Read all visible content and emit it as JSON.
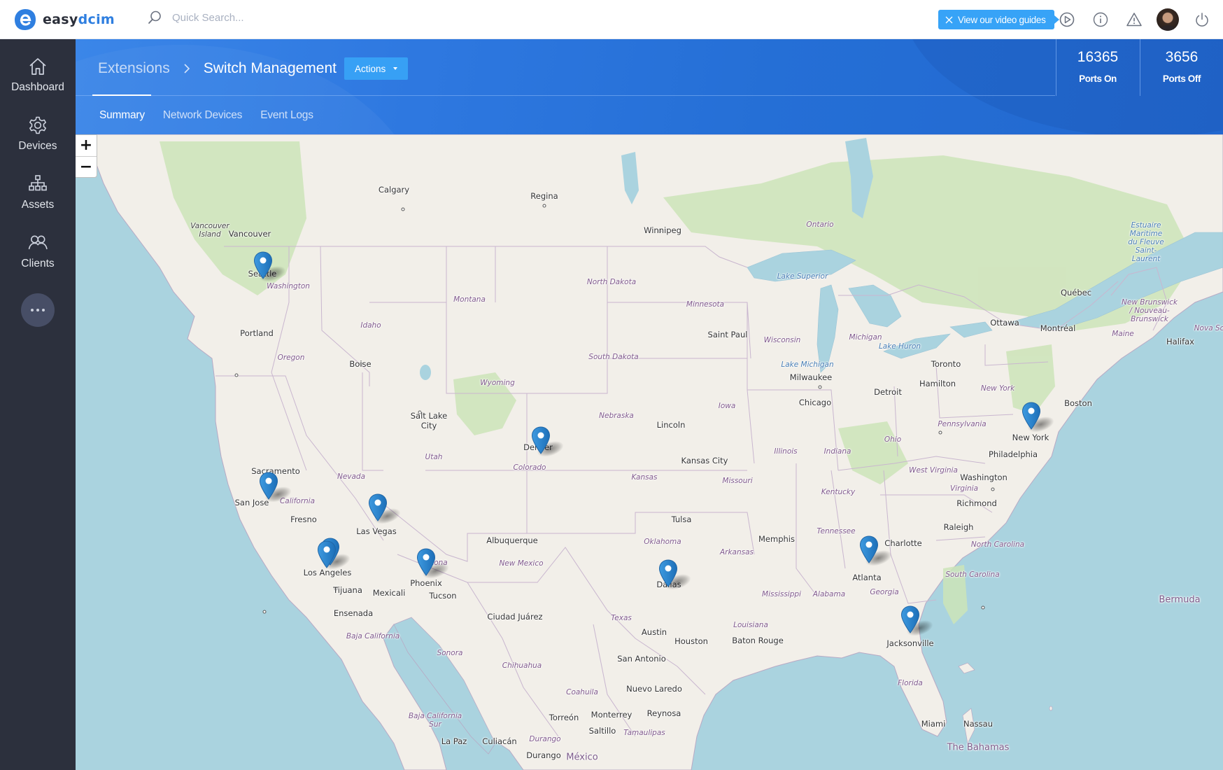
{
  "topbar": {
    "logo": {
      "prefix": "easy",
      "suffix": "dcim"
    },
    "search_placeholder": "Quick Search...",
    "video_guide_label": "View our video guides",
    "icons": [
      "search-icon",
      "close-icon",
      "play-circle-icon",
      "info-icon",
      "warning-icon",
      "avatar",
      "power-icon"
    ]
  },
  "sidebar": {
    "items": [
      {
        "label": "Dashboard",
        "icon": "home-icon"
      },
      {
        "label": "Devices",
        "icon": "gear-icon"
      },
      {
        "label": "Assets",
        "icon": "sitemap-icon"
      },
      {
        "label": "Clients",
        "icon": "users-icon"
      }
    ],
    "more_icon": "more-horizontal-icon"
  },
  "header": {
    "breadcrumb": {
      "parent": "Extensions",
      "current": "Switch Management"
    },
    "actions_label": "Actions",
    "tabs": [
      {
        "label": "Summary",
        "active": true
      },
      {
        "label": "Network Devices",
        "active": false
      },
      {
        "label": "Event Logs",
        "active": false
      }
    ],
    "stats": [
      {
        "value": "16365",
        "label": "Ports On"
      },
      {
        "value": "3656",
        "label": "Ports Off"
      }
    ]
  },
  "map": {
    "zoom_in": "+",
    "zoom_out": "−",
    "markers": [
      "Seattle",
      "San Jose",
      "Las Vegas",
      "Los Angeles",
      "Los Angeles",
      "Phoenix",
      "Denver",
      "Dallas",
      "Atlanta",
      "Jacksonville",
      "New York"
    ],
    "cities": [
      "Calgary",
      "Regina",
      "Winnipeg",
      "Vancouver",
      "Seattle",
      "Portland",
      "Boise",
      "Salt Lake City",
      "Sacramento",
      "San Jose",
      "Fresno",
      "Las Vegas",
      "Los Angeles",
      "Tijuana",
      "Mexicali",
      "Ensenada",
      "Phoenix",
      "Tucson",
      "Albuquerque",
      "Ciudad Juárez",
      "Denver",
      "Lincoln",
      "Kansas City",
      "Tulsa",
      "Dallas",
      "Austin",
      "Houston",
      "San Antonio",
      "Nuevo Laredo",
      "Reynosa",
      "Monterrey",
      "Saltillo",
      "Torreón",
      "Durango",
      "Culiacán",
      "La Paz",
      "Saint Paul",
      "Milwaukee",
      "Chicago",
      "Detroit",
      "Toronto",
      "Hamilton",
      "Ottawa",
      "Montréal",
      "Québec",
      "Halifax",
      "Boston",
      "New York",
      "Philadelphia",
      "Washington",
      "Richmond",
      "Raleigh",
      "Charlotte",
      "Memphis",
      "Atlanta",
      "Baton Rouge",
      "Jacksonville",
      "Miami",
      "Nassau"
    ],
    "regions": [
      "Vancouver Island",
      "Washington",
      "Oregon",
      "Idaho",
      "Montana",
      "Wyoming",
      "Nevada",
      "Utah",
      "California",
      "Colorado",
      "Arizona",
      "New Mexico",
      "North Dakota",
      "South Dakota",
      "Nebraska",
      "Kansas",
      "Oklahoma",
      "Texas",
      "Minnesota",
      "Iowa",
      "Missouri",
      "Arkansas",
      "Louisiana",
      "Mississippi",
      "Alabama",
      "Tennessee",
      "Kentucky",
      "Illinois",
      "Indiana",
      "Ohio",
      "Wisconsin",
      "Michigan",
      "Pennsylvania",
      "New York",
      "West Virginia",
      "Virginia",
      "North Carolina",
      "South Carolina",
      "Georgia",
      "Florida",
      "Maine",
      "Ontario",
      "New Brunswick / Nouveau-Brunswick",
      "Nova Scotia",
      "Sonora",
      "Chihuahua",
      "Coahuila",
      "Durango",
      "Tamaulipas",
      "Baja California",
      "Baja California Sur"
    ],
    "waters": [
      "Lake Superior",
      "Lake Michigan",
      "Lake Huron",
      "Estuaire Maritime du Fleuve Saint-Laurent"
    ],
    "countries": [
      "México",
      "The Bahamas",
      "Bermuda"
    ]
  }
}
